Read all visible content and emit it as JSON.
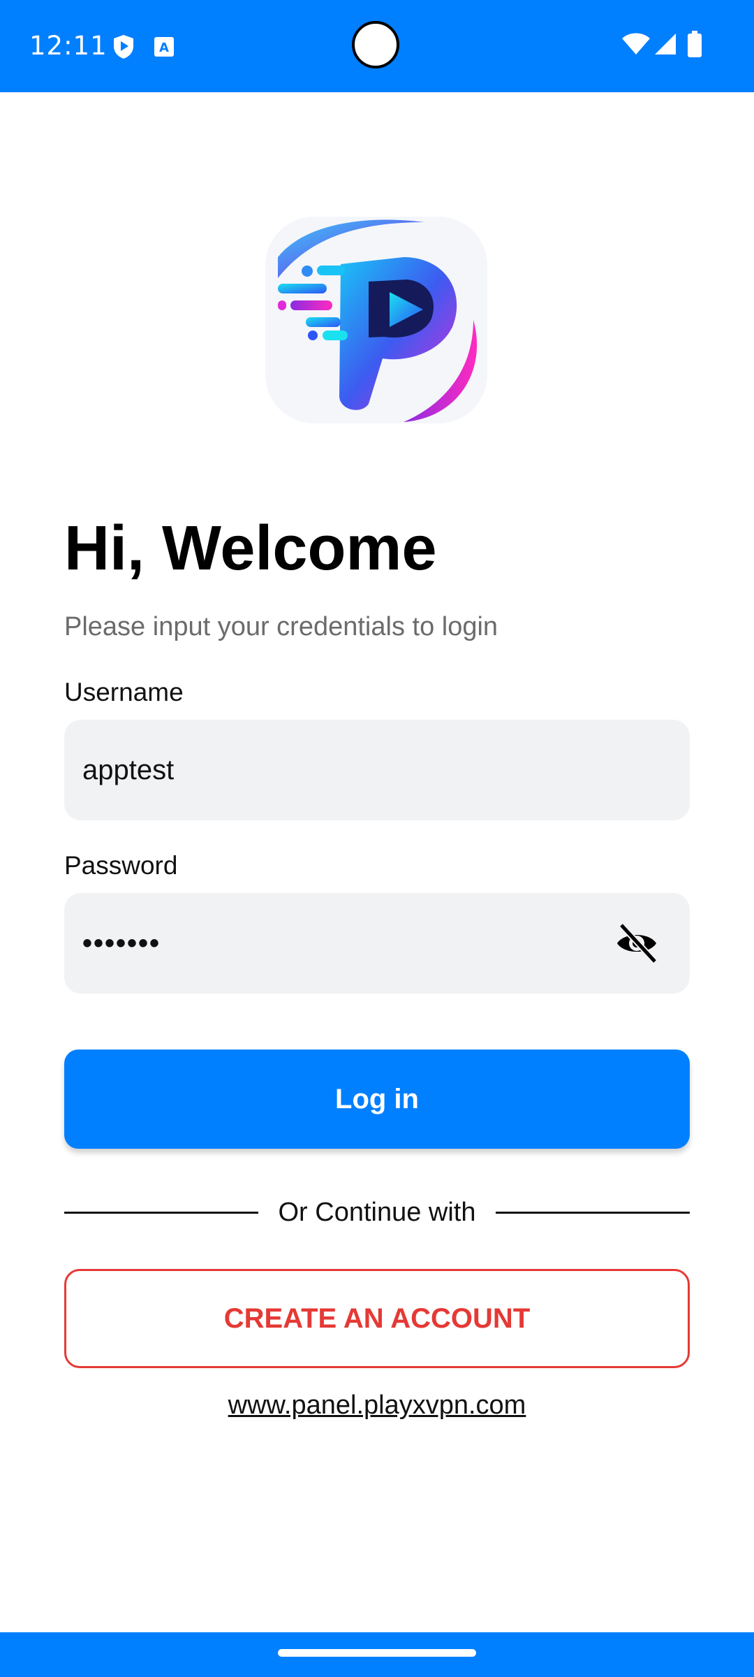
{
  "status_bar": {
    "time": "12:11",
    "background_color": "#007FFF",
    "icons": [
      "shield-play-icon",
      "text-a-icon",
      "wifi-icon",
      "cellular-signal-icon",
      "battery-icon"
    ]
  },
  "logo": {
    "icon": "playx-p-play-logo"
  },
  "header": {
    "title": "Hi, Welcome",
    "subtitle": "Please input your credentials to login"
  },
  "form": {
    "username": {
      "label": "Username",
      "value": "apptest"
    },
    "password": {
      "label": "Password",
      "masked_value": "•••••••",
      "visibility_icon": "eye-off-icon"
    }
  },
  "actions": {
    "login_label": "Log in",
    "divider_text": "Or Continue with",
    "create_account_label": "CREATE AN ACCOUNT",
    "website_link": "www.panel.playxvpn.com"
  },
  "colors": {
    "primary": "#007FFF",
    "danger": "#E53935",
    "input_bg": "#F1F2F4",
    "subtitle": "#6B6B6B"
  }
}
